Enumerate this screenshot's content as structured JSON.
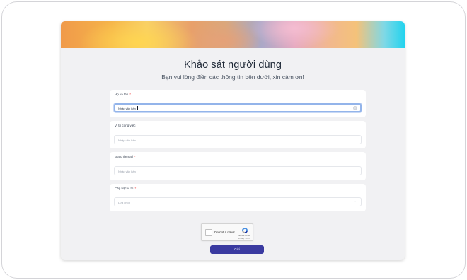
{
  "form": {
    "title": "Khảo sát người dùng",
    "subtitle": "Bạn vui lòng điền các thông tin bên dưới, xin cảm ơn!"
  },
  "fields": [
    {
      "label": "Họ và tên",
      "required_mark": "*",
      "placeholder": "Nhập văn bản",
      "focused": true
    },
    {
      "label": "Vị trí công việc",
      "required_mark": "",
      "placeholder": "Nhập văn bản"
    },
    {
      "label": "Địa chỉ email",
      "required_mark": "*",
      "placeholder": "Nhập văn bản"
    },
    {
      "label": "Cấp bậc vị trí",
      "required_mark": "*",
      "placeholder": "Lựa chọn"
    }
  ],
  "captcha": {
    "label": "I'm not a robot",
    "brand": "reCAPTCHA",
    "links": "Privacy - Terms"
  },
  "submit_label": "Gửi",
  "colors": {
    "accent": "#3a3aa0",
    "focus_ring": "#93b4ea",
    "required": "#ef4444",
    "card_bg": "#f1f1f3"
  },
  "icons": {
    "clear": "clear-icon",
    "dropdown": "chevron-down-icon",
    "captcha_logo": "recaptcha-logo-icon"
  }
}
